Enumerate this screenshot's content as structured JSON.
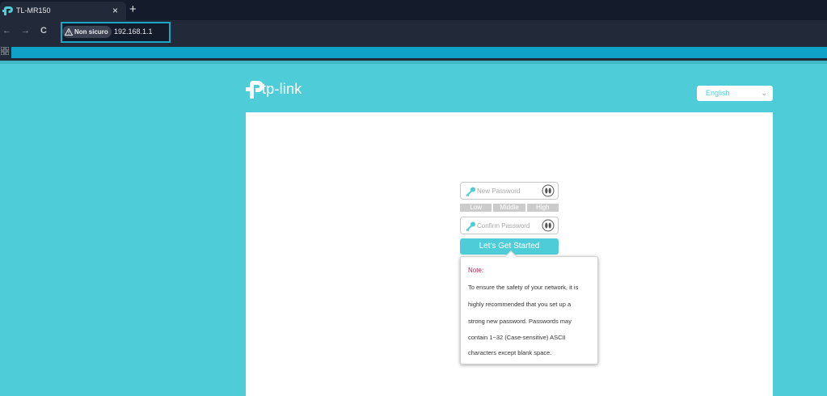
{
  "browser": {
    "tab_title": "TL-MR150",
    "tab_close": "×",
    "new_tab": "+",
    "nav": {
      "back": "←",
      "forward": "→",
      "reload": "C"
    },
    "security_label": "Non sicuro",
    "url": "192.168.1.1"
  },
  "header": {
    "logo_text": "tp-link",
    "language": {
      "selected": "English",
      "chevron": "⌄"
    }
  },
  "form": {
    "new_password_placeholder": "New Password",
    "confirm_password_placeholder": "Confirm Password",
    "strength_levels": [
      "Low",
      "Middle",
      "High"
    ],
    "submit_label": "Let's Get Started"
  },
  "note": {
    "title": "Note:",
    "lines": [
      "To ensure the safety of your network, it is",
      "highly recommended that you set up a",
      "strong new password. Passwords may",
      "contain 1~32 (Case-sensitive) ASCII",
      "characters except blank space."
    ]
  },
  "colors": {
    "brand": "#4ecdd8",
    "note_title": "#b5275b",
    "strength_bar": "#cccccc",
    "highlight_outline": "#19a6c9"
  }
}
